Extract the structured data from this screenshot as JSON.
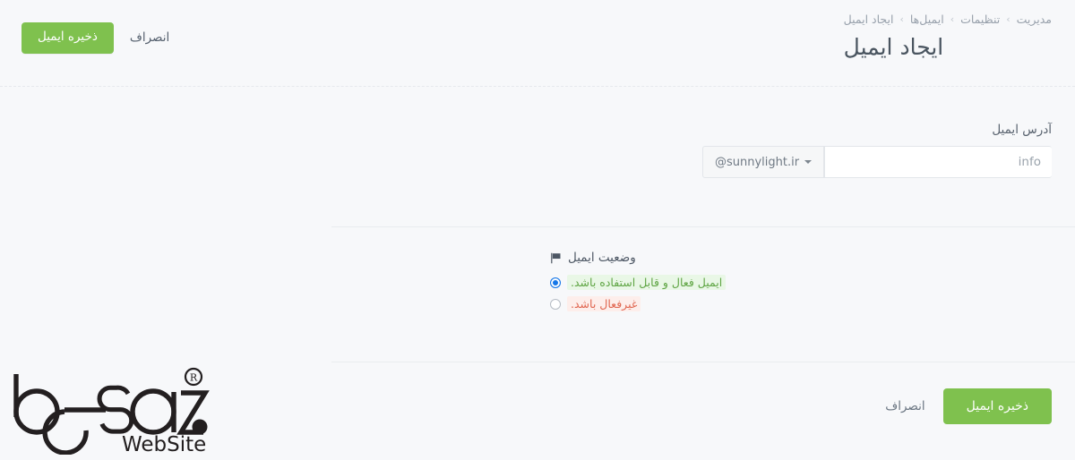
{
  "header": {
    "breadcrumb": [
      {
        "label": "مدیریت"
      },
      {
        "label": "تنظیمات"
      },
      {
        "label": "ایمیل‌ها"
      },
      {
        "label": "ایجاد ایمیل"
      }
    ],
    "separator": "›",
    "title": "ایجاد ایمیل",
    "save_label": "ذخیره ایمیل",
    "cancel_label": "انصراف"
  },
  "form": {
    "email_address": {
      "label": "آدرس ایمیل",
      "input_value": "",
      "input_placeholder": "info",
      "domain_label": "@sunnylight.ir",
      "domain_icon": "chevron-down-icon"
    },
    "status": {
      "label": "وضعیت ایمیل",
      "icon": "flag-icon",
      "options": [
        {
          "label": "ایمیل فعال و قابل استفاده باشد.",
          "selected": true,
          "state": "active"
        },
        {
          "label": "غیرفعال باشد.",
          "selected": false,
          "state": "inactive"
        }
      ]
    }
  },
  "footer": {
    "save_label": "ذخیره ایمیل",
    "cancel_label": "انصراف"
  },
  "logo": {
    "name": "besaz",
    "registered_mark": "®",
    "subtitle": "WebSite"
  },
  "colors": {
    "brand_green": "#7fc14e",
    "radio_selected": "#1677e8",
    "status_active_text": "#5fa544",
    "status_active_bg": "#e9f7e6",
    "status_inactive_text": "#e0654f",
    "status_inactive_bg": "#fdeeeb",
    "page_bg": "#f7f8fa",
    "title_text": "#4a5560",
    "muted_text": "#97a0ab"
  }
}
